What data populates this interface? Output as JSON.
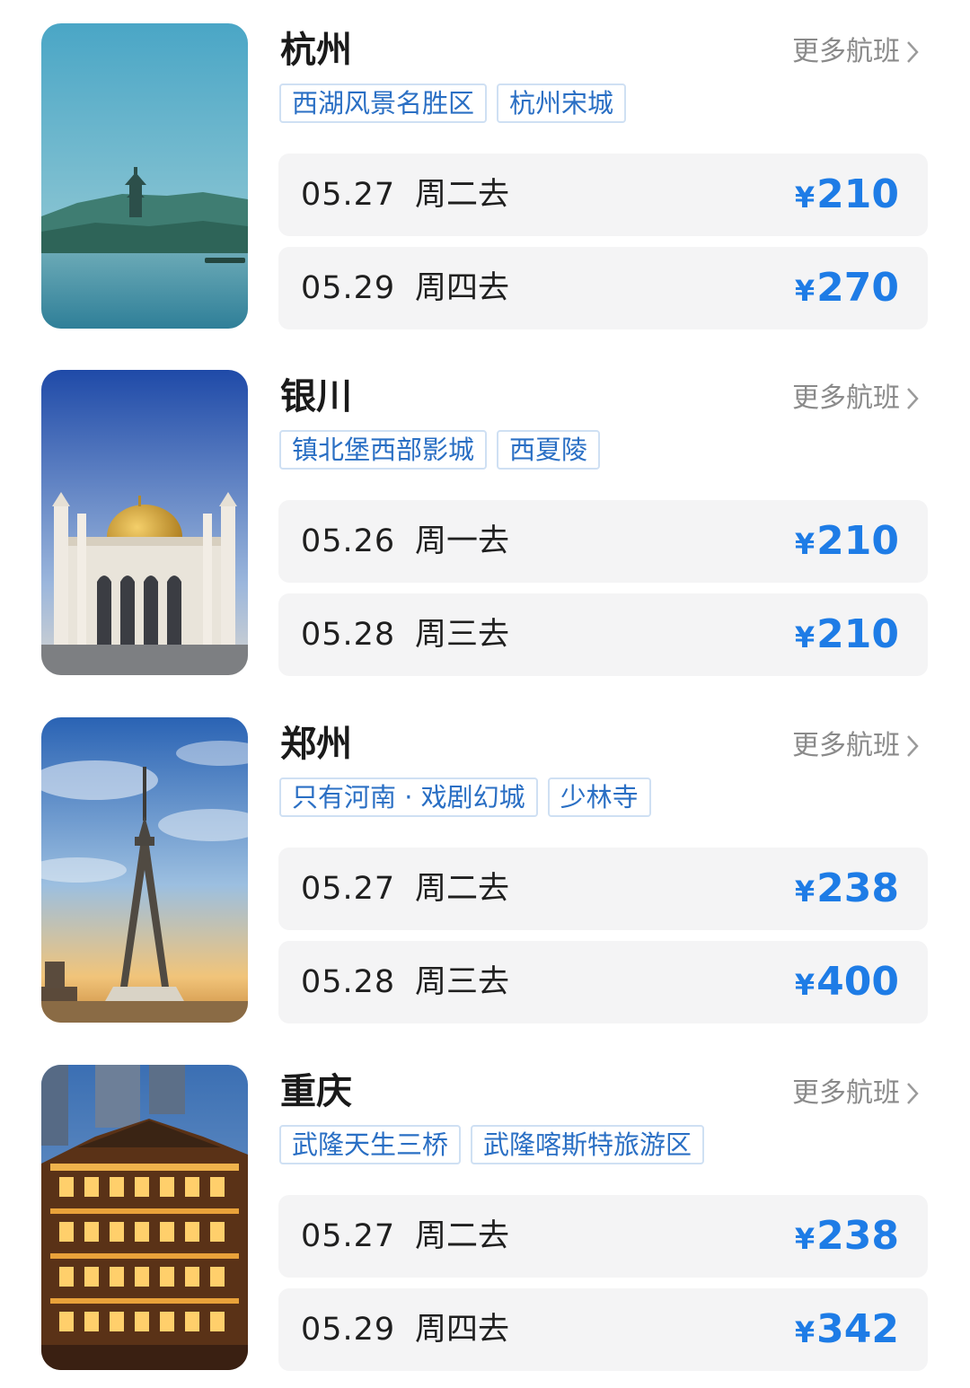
{
  "cards": [
    {
      "city": "杭州",
      "more": "更多航班",
      "tags": [
        "西湖风景名胜区",
        "杭州宋城"
      ],
      "flights": [
        {
          "date": "05.27",
          "day": "周二去",
          "currency": "¥",
          "price": "210"
        },
        {
          "date": "05.29",
          "day": "周四去",
          "currency": "¥",
          "price": "270"
        }
      ]
    },
    {
      "city": "银川",
      "more": "更多航班",
      "tags": [
        "镇北堡西部影城",
        "西夏陵"
      ],
      "flights": [
        {
          "date": "05.26",
          "day": "周一去",
          "currency": "¥",
          "price": "210"
        },
        {
          "date": "05.28",
          "day": "周三去",
          "currency": "¥",
          "price": "210"
        }
      ]
    },
    {
      "city": "郑州",
      "more": "更多航班",
      "tags": [
        "只有河南 · 戏剧幻城",
        "少林寺"
      ],
      "flights": [
        {
          "date": "05.27",
          "day": "周二去",
          "currency": "¥",
          "price": "238"
        },
        {
          "date": "05.28",
          "day": "周三去",
          "currency": "¥",
          "price": "400"
        }
      ]
    },
    {
      "city": "重庆",
      "more": "更多航班",
      "tags": [
        "武隆天生三桥",
        "武隆喀斯特旅游区"
      ],
      "flights": [
        {
          "date": "05.27",
          "day": "周二去",
          "currency": "¥",
          "price": "238"
        },
        {
          "date": "05.29",
          "day": "周四去",
          "currency": "¥",
          "price": "342"
        }
      ]
    }
  ],
  "colors": {
    "price": "#1e7ce6",
    "tag_text": "#2a6fc4",
    "tag_border": "#cfe0f3",
    "row_bg": "#f4f4f5",
    "more_text": "#8a8a8a"
  },
  "icons": {
    "more_arrow": "chevron-right-icon"
  }
}
